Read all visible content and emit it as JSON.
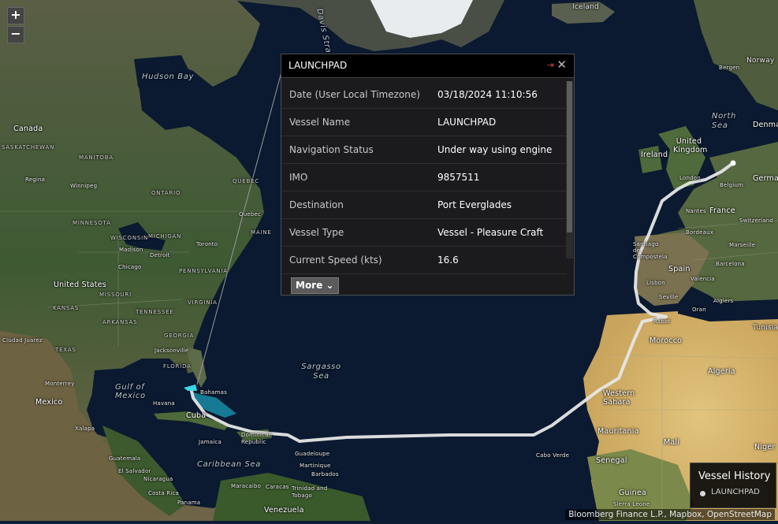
{
  "map": {
    "zoom_in": "+",
    "zoom_out": "−",
    "labels": {
      "iceland": "Iceland",
      "davis_strait": "Davis Strait",
      "hudson_bay": "Hudson Bay",
      "canada": "Canada",
      "saskatchewan": "SASKATCHEWAN",
      "manitoba": "MANITOBA",
      "ontario": "ONTARIO",
      "quebec_prov": "QUEBEC",
      "regina": "Regina",
      "winnipeg": "Winnipeg",
      "minnesota": "MINNESOTA",
      "michigan": "MICHIGAN",
      "wisconsin": "WISCONSIN",
      "maine": "MAINE",
      "quebec_city": "Quebec",
      "toronto": "Toronto",
      "madison": "Madison",
      "detroit": "Detroit",
      "chicago": "Chicago",
      "united_states": "United States",
      "pennsylvania": "PENNSYLVANIA",
      "virginia": "VIRGINIA",
      "kansas": "KANSAS",
      "missouri": "MISSOURI",
      "tennessee": "TENNESSEE",
      "arkansas": "ARKANSAS",
      "georgia": "GEORGIA",
      "texas": "TEXAS",
      "florida": "FLORIDA",
      "jacksonville": "Jacksonville",
      "ciudad_juarez": "Ciudad Juarez",
      "monterrey": "Monterrey",
      "mexico": "Mexico",
      "gulf_of_mexico": "Gulf of Mexico",
      "havana": "Havana",
      "cuba": "Cuba",
      "bahamas": "Bahamas",
      "jamaica": "Jamaica",
      "dominican_republic": "Dominican Republic",
      "guadeloupe": "Guadeloupe",
      "martinique": "Martinique",
      "barbados": "Barbados",
      "caribbean_sea": "Caribbean Sea",
      "xalapa": "Xalapa",
      "guatemala": "Guatemala",
      "el_salvador": "El Salvador",
      "nicaragua": "Nicaragua",
      "costa_rica": "Costa Rica",
      "panama": "Panama",
      "maracaibo": "Maracaibo",
      "caracas": "Caracas",
      "trinidad": "Trinidad and Tobago",
      "venezuela": "Venezuela",
      "sargasso_sea": "Sargasso Sea",
      "cabo_verde": "Cabo Verde",
      "norway": "Norway",
      "bergen": "Bergen",
      "north_sea": "North Sea",
      "denmark": "Denmark",
      "ireland": "Ireland",
      "united_kingdom": "United Kingdom",
      "london": "London",
      "belgium": "Belgium",
      "germany": "German",
      "nantes": "Nantes",
      "france": "France",
      "switzerland": "Switzerland",
      "bordeaux": "Bordeaux",
      "marseille": "Marseille",
      "santiago": "Santiago de Compostela",
      "spain": "Spain",
      "valencia": "Valencia",
      "barcelona": "Barcelona",
      "lisbon": "Lisbon",
      "seville": "Seville",
      "algiers": "Algiers",
      "oran": "Oran",
      "rabat": "Rabat",
      "tunisia": "Tunisia",
      "morocco": "Morocco",
      "algeria": "Algeria",
      "western_sahara": "Western Sahara",
      "mauritania": "Mauritania",
      "mali": "Mali",
      "niger": "Niger",
      "senegal": "Senegal",
      "guinea": "Guinea",
      "sierra_leone": "Sierra Leone"
    }
  },
  "popup": {
    "title": "LAUNCHPAD",
    "pin_icon": "⇥",
    "close_icon": "✕",
    "rows": [
      {
        "label": "Date (User Local Timezone)",
        "value": "03/18/2024 11:10:56"
      },
      {
        "label": "Vessel Name",
        "value": "LAUNCHPAD"
      },
      {
        "label": "Navigation Status",
        "value": "Under way using engine"
      },
      {
        "label": "IMO",
        "value": "9857511"
      },
      {
        "label": "Destination",
        "value": "Port Everglades"
      },
      {
        "label": "Vessel Type",
        "value": "Vessel - Pleasure Craft"
      },
      {
        "label": "Current Speed (kts)",
        "value": "16.6"
      }
    ],
    "more_label": "More",
    "more_icon": "⌄"
  },
  "legend": {
    "title": "Vessel History",
    "item": "LAUNCHPAD"
  },
  "attribution": "Bloomberg Finance L.P., Mapbox, OpenStreetMap",
  "colors": {
    "route": "#e6e6e6",
    "route_highlight": "#39d6e6",
    "ocean": "#0d1d33"
  }
}
